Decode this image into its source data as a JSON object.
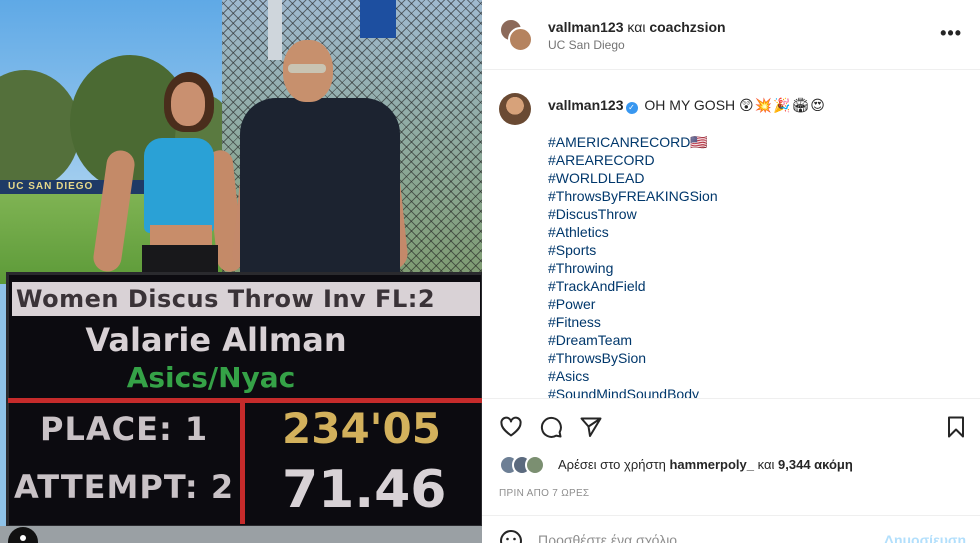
{
  "photo": {
    "banner": "UC SAN DIEGO",
    "scoreboard": {
      "event": "Women Discus Throw Inv  FL:2",
      "athlete": "Valarie Allman",
      "team": "Asics/Nyac",
      "place_label": "PLACE: 1",
      "attempt_label": "ATTEMPT: 2",
      "mark_feet": "234'05",
      "mark_meters": "71.46"
    }
  },
  "header": {
    "user1": "vallman123",
    "conjunction": "και",
    "user2": "coachzsion",
    "location": "UC San Diego",
    "more": "•••"
  },
  "caption": {
    "username": "vallman123",
    "verified_icon": "✓",
    "text": "OH MY GOSH",
    "emojis": "😲💥🎉🏟😍",
    "hashtags": [
      "#AMERICANRECORD🇺🇸",
      "#AREARECORD",
      "#WORLDLEAD",
      "#ThrowsByFREAKINGSion",
      "#DiscusThrow",
      "#Athletics",
      "#Sports",
      "#Throwing",
      "#TrackAndField",
      "#Power",
      "#Fitness",
      "#DreamTeam",
      "#ThrowsBySion",
      "#Asics",
      "#SoundMindSoundBody"
    ]
  },
  "likes": {
    "prefix": "Αρέσει στο χρήστη",
    "user": "hammerpoly_",
    "conjunction": "και",
    "count": "9,344 ακόμη"
  },
  "timestamp": "ΠΡΙΝ ΑΠΟ 7 ΩΡΕΣ",
  "comment": {
    "placeholder": "Προσθέστε ένα σχόλιο...",
    "post_label": "Δημοσίευση"
  },
  "colors": {
    "link": "#00376b",
    "verified": "#3897f0",
    "post_disabled": "#b2dffc"
  }
}
